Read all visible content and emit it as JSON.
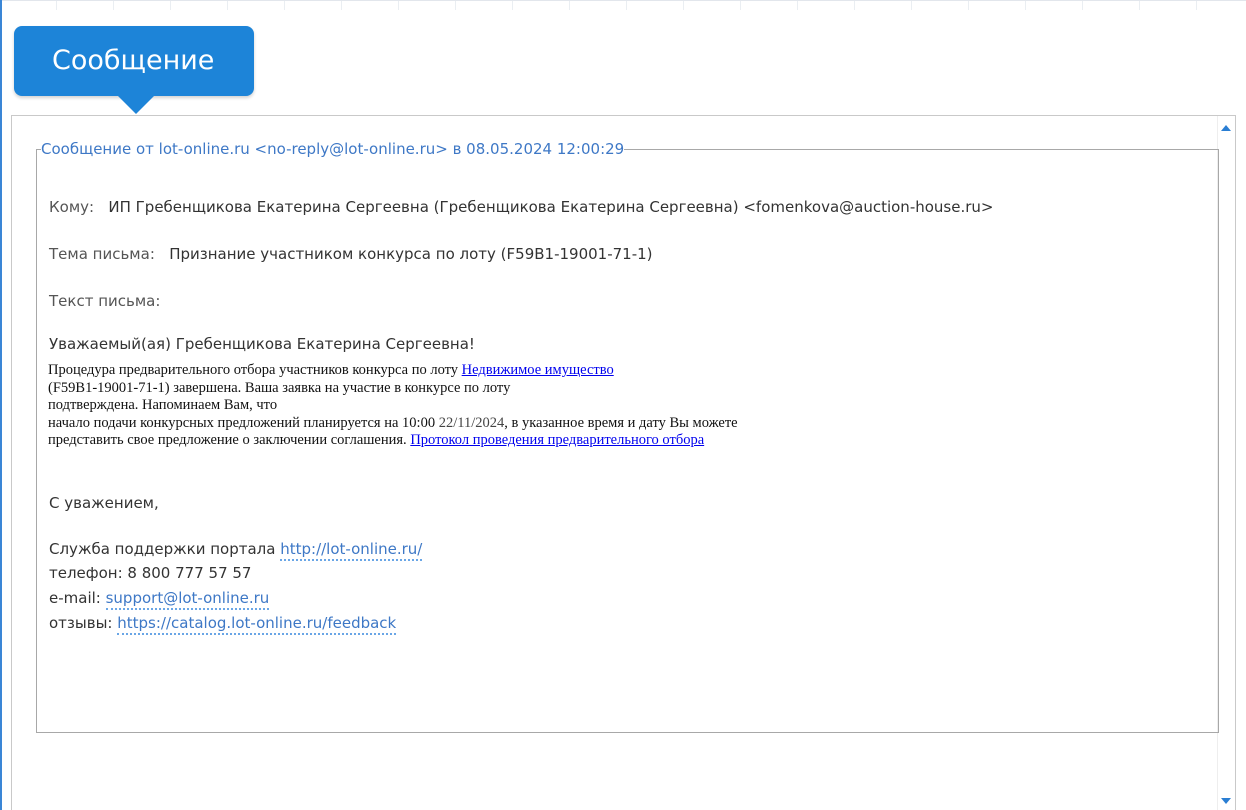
{
  "tab": {
    "title": "Сообщение"
  },
  "message": {
    "legend": "Сообщение от lot-online.ru <no-reply@lot-online.ru> в 08.05.2024 12:00:29",
    "to_label": "Кому:",
    "to_value": "ИП Гребенщикова Екатерина Сергеевна (Гребенщикова Екатерина Сергеевна) <fomenkova@auction-house.ru>",
    "subject_label": "Тема письма:",
    "subject_value": "Признание участником конкурса по лоту (F59B1-19001-71-1)",
    "body_label": "Текст письма:",
    "greeting": "Уважаемый(ая) Гребенщикова Екатерина Сергеевна!",
    "body": {
      "l1_prefix": "Процедура предварительного отбора участников конкурса по лоту ",
      "l1_link": "Недвижимое имущество",
      "l2": "(F59B1-19001-71-1)  завершена. Ваша заявка на участие в конкурсе по лоту",
      "l3": "подтверждена. Напоминаем Вам, что",
      "l4_prefix": "начало подачи конкурсных предложений планируется на 10:00 ",
      "l4_date": "22/11/2024",
      "l4_suffix": ", в указанное время и дату Вы можете",
      "l5_prefix": "представить свое предложение о заключении соглашения. ",
      "l5_link": "Протокол проведения предварительного отбора"
    },
    "closing": "С уважением,",
    "support_prefix": "Служба поддержки портала ",
    "support_link": "http://lot-online.ru/",
    "phone": "телефон: 8 800 777 57 57",
    "email_label": "e-mail: ",
    "email_link": "support@lot-online.ru",
    "feedback_label": "отзывы: ",
    "feedback_link": "https://catalog.lot-online.ru/feedback"
  }
}
